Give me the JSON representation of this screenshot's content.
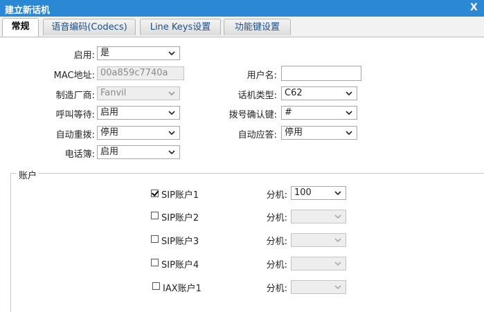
{
  "window": {
    "title": "建立新话机",
    "close_label": "X"
  },
  "tabs": [
    {
      "label": "常规"
    },
    {
      "label": "语音编码(Codecs)"
    },
    {
      "label": "Line Keys设置"
    },
    {
      "label": "功能键设置"
    }
  ],
  "general": {
    "enable": {
      "label": "启用:",
      "value": "是"
    },
    "mac": {
      "label": "MAC地址:",
      "value": "00a859c7740a"
    },
    "username": {
      "label": "用户名:",
      "value": ""
    },
    "vendor": {
      "label": "制造厂商:",
      "value": "Fanvil"
    },
    "phone_model": {
      "label": "话机类型:",
      "value": "C62"
    },
    "call_waiting": {
      "label": "呼叫等待:",
      "value": "启用"
    },
    "dial_confirm_key": {
      "label": "拨号确认键:",
      "value": "#"
    },
    "auto_redial": {
      "label": "自动重拨:",
      "value": "停用"
    },
    "auto_answer": {
      "label": "自动应答:",
      "value": "停用"
    },
    "phonebook": {
      "label": "电话簿:",
      "value": "启用"
    }
  },
  "accounts": {
    "legend": "账户",
    "ext_label": "分机:",
    "items": [
      {
        "label": "SIP账户1",
        "checked": true,
        "extension": "100"
      },
      {
        "label": "SIP账户2",
        "checked": false,
        "extension": ""
      },
      {
        "label": "SIP账户3",
        "checked": false,
        "extension": ""
      },
      {
        "label": "SIP账户4",
        "checked": false,
        "extension": ""
      },
      {
        "label": "IAX账户1",
        "checked": false,
        "extension": ""
      }
    ]
  }
}
